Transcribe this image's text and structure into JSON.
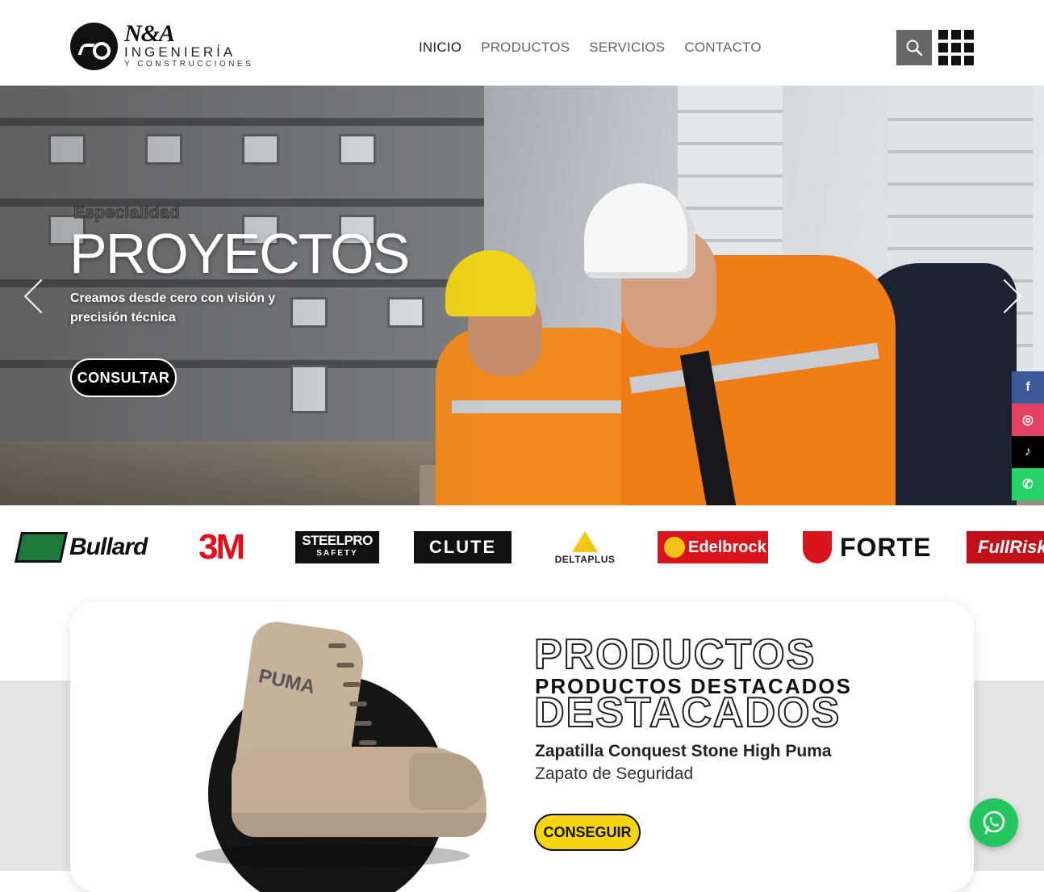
{
  "brand": {
    "logo_name": "N&A",
    "logo_line1": "INGENIERÍA",
    "logo_line2": "Y CONSTRUCCIONES"
  },
  "nav": {
    "items": [
      {
        "label": "INICIO",
        "active": true
      },
      {
        "label": "PRODUCTOS",
        "active": false
      },
      {
        "label": "SERVICIOS",
        "active": false
      },
      {
        "label": "CONTACTO",
        "active": false
      }
    ]
  },
  "header_icons": {
    "search": "search-icon",
    "menu": "grid-menu-icon"
  },
  "hero": {
    "eyebrow": "Especialidad",
    "title": "PROYECTOS",
    "subtitle": "Creamos desde cero con visión y precisión técnica",
    "cta": "CONSULTAR"
  },
  "social": [
    "f",
    "◎",
    "♪",
    "✆"
  ],
  "brands": [
    "Bullard",
    "3M",
    "STEELPRO",
    "SAFETY",
    "CLUTE",
    "DELTAPLUS",
    "Edelbrock",
    "FORTE",
    "FullRisk"
  ],
  "featured": {
    "outline_top": "PRODUCTOS",
    "heading": "PRODUCTOS DESTACADOS",
    "outline_bottom": "DESTACADOS",
    "product_name": "Zapatilla Conquest Stone High Puma",
    "product_category": "Zapato de Seguridad",
    "boot_label": "PUMA",
    "cta": "CONSEGUIR"
  },
  "colors": {
    "accent_yellow": "#f8d512",
    "whatsapp_green": "#22c55e",
    "section_bg": "#e6e3e3"
  }
}
